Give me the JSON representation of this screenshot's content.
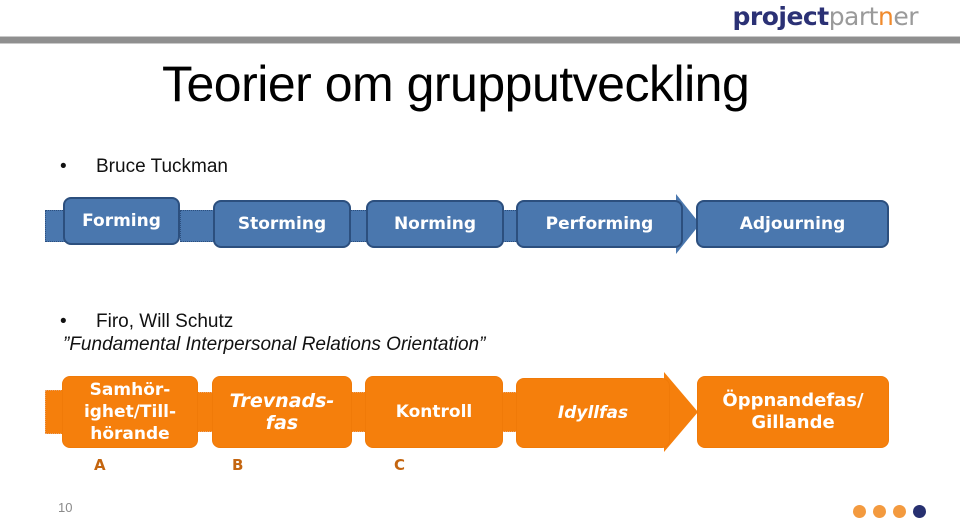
{
  "header": {
    "logo_part1": "project",
    "logo_part2": "part",
    "logo_dot": "n",
    "logo_part3": "er"
  },
  "title": "Teorier om grupputveckling",
  "bullets": [
    {
      "text": "Bruce Tuckman"
    },
    {
      "text": "Firo, Will Schutz",
      "subtitle": "”Fundamental Interpersonal Relations Orientation”"
    }
  ],
  "tuckman_stages": [
    "Forming",
    "Storming",
    "Norming",
    "Performing",
    "Adjourning"
  ],
  "firo_stages": [
    {
      "line1": "Samhör-",
      "line2": "ighet/Till-",
      "line3": "hörande",
      "italic": false
    },
    {
      "line1": "Trevnads-",
      "line2": "fas",
      "italic": true
    },
    {
      "line1": "Kontroll",
      "italic": false
    },
    {
      "line1": "Idyllfas",
      "italic": true
    },
    {
      "line1": "Öppnandefas/",
      "line2": "Gillande",
      "italic": false
    }
  ],
  "firo_letters": [
    "A",
    "B",
    "C"
  ],
  "footer": {
    "page_number": "10",
    "progress_dots": [
      "#f39a3f",
      "#f39a3f",
      "#f39a3f",
      "#273070"
    ]
  },
  "colors": {
    "tuckman_fill": "#4a77ae",
    "firo_fill": "#f57f0c",
    "letter_color": "#c4650f"
  }
}
